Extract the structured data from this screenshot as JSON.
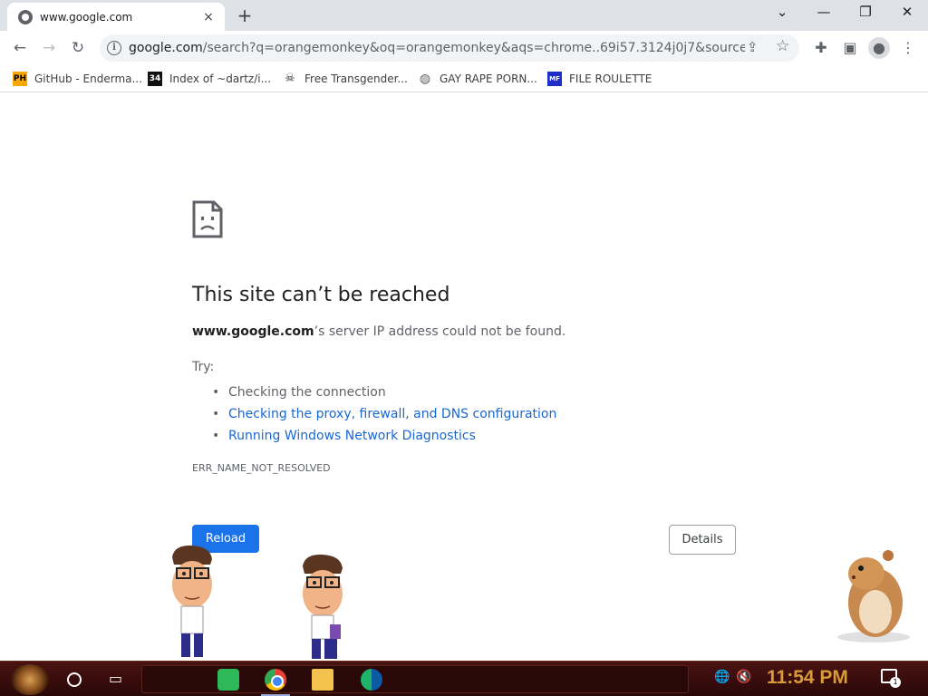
{
  "tab": {
    "title": "www.google.com",
    "close_icon": "×",
    "new_tab_icon": "+"
  },
  "window_controls": {
    "chevron": "⌄",
    "minimize": "—",
    "restore": "❐",
    "close": "✕"
  },
  "toolbar": {
    "back": "←",
    "forward": "→",
    "reload": "↻",
    "url_host": "google.com",
    "url_rest": "/search?q=orangemonkey&oq=orangemonkey&aqs=chrome..69i57.3124j0j7&sourceid=chrom...",
    "share_icon": "⇪",
    "star_icon": "☆",
    "extensions_icon": "✚",
    "sidepanel_icon": "▣",
    "profile_icon": "●",
    "menu_icon": "⋮"
  },
  "bookmarks": [
    {
      "label": "GitHub - Enderma...",
      "icon_text": "PH",
      "icon_bg": "#f7a800",
      "icon_fg": "#000000"
    },
    {
      "label": "Index of ~dartz/i...",
      "icon_text": "34",
      "icon_bg": "#111111",
      "icon_fg": "#ffffff"
    },
    {
      "label": "Free Transgender...",
      "icon_text": "☠",
      "icon_bg": "#ffffff",
      "icon_fg": "#333333"
    },
    {
      "label": "GAY RAPE PORN...",
      "icon_text": "◍",
      "icon_bg": "#ffffff",
      "icon_fg": "#5f6368"
    },
    {
      "label": "FILE ROULETTE",
      "icon_text": "MF",
      "icon_bg": "#1e2ec8",
      "icon_fg": "#ffffff"
    }
  ],
  "error": {
    "title": "This site can’t be reached",
    "host": "www.google.com",
    "desc_rest": "’s server IP address could not be found.",
    "try_label": "Try:",
    "suggestions": [
      "Checking the connection",
      "Checking the proxy, firewall, and DNS configuration",
      "Running Windows Network Diagnostics"
    ],
    "code": "ERR_NAME_NOT_RESOLVED",
    "reload_label": "Reload",
    "details_label": "Details"
  },
  "taskbar": {
    "clock": "11:54 PM",
    "notification_count": "1",
    "tray_network_icon": "🌐",
    "tray_volume_icon": "🔇"
  },
  "colors": {
    "link": "#1967d2",
    "reload_bg": "#1a73e8",
    "clock": "#d99a3a",
    "taskbar": "#3a0c0c"
  }
}
